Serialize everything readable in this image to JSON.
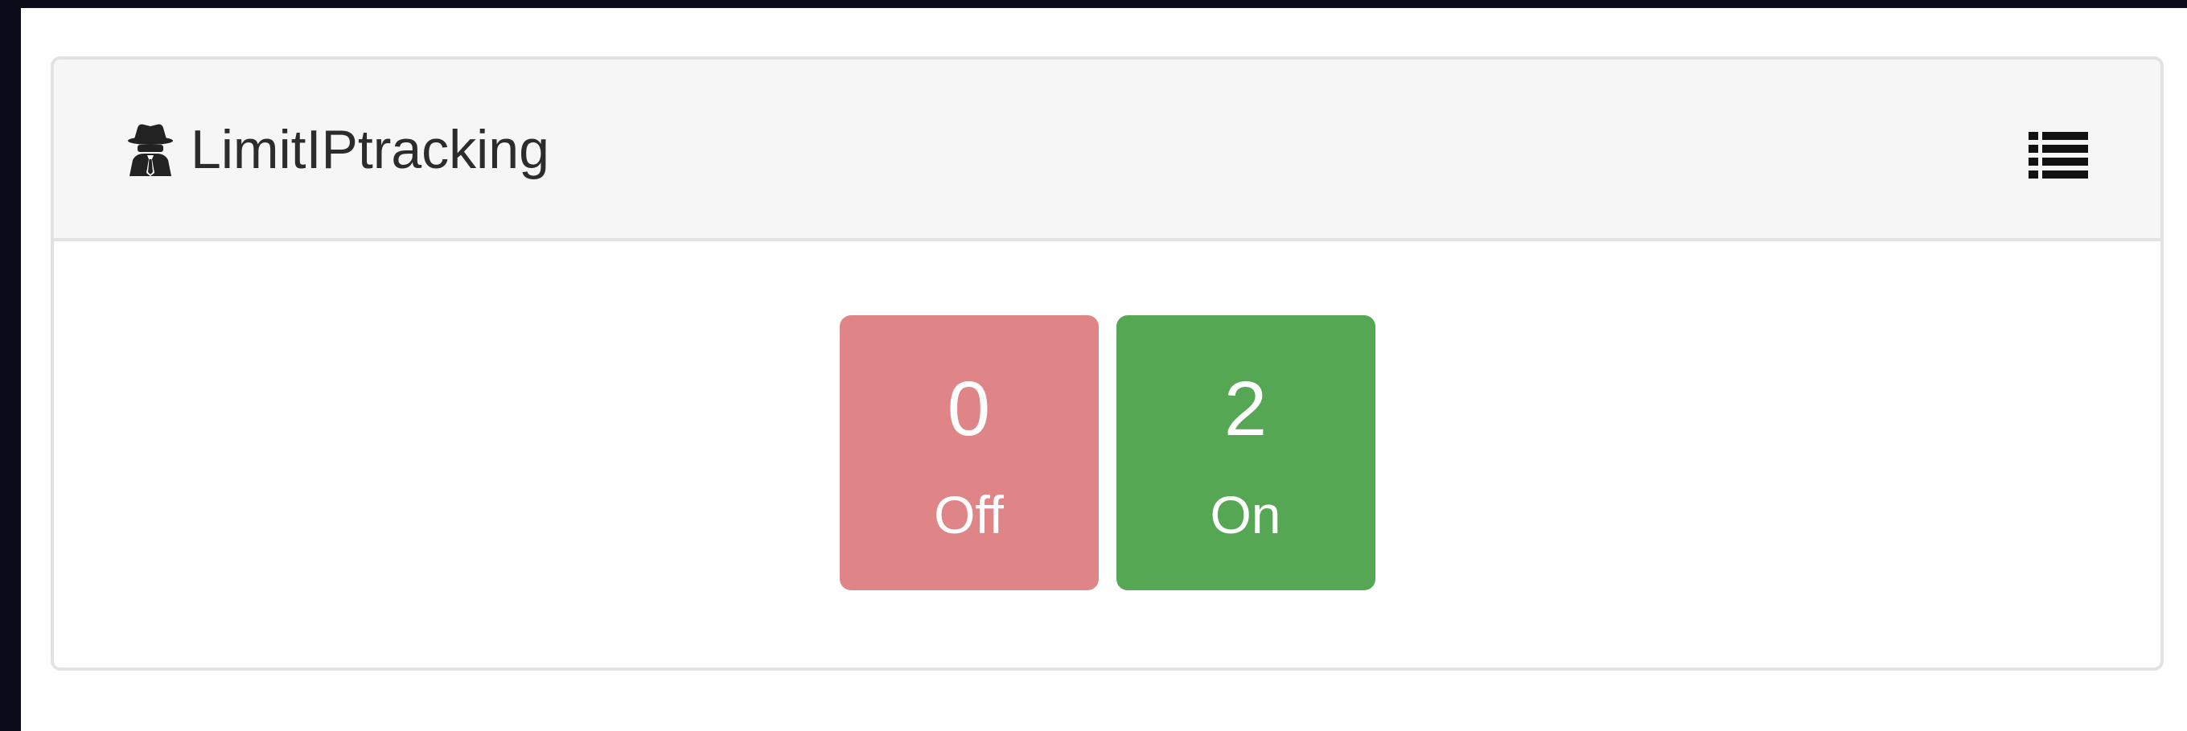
{
  "widget": {
    "title": "LimitIPtracking",
    "title_icon": "spy-icon",
    "menu_icon": "list-icon"
  },
  "tiles": [
    {
      "count": "0",
      "label": "Off",
      "color": "#df8588"
    },
    {
      "count": "2",
      "label": "On",
      "color": "#55a753"
    }
  ]
}
